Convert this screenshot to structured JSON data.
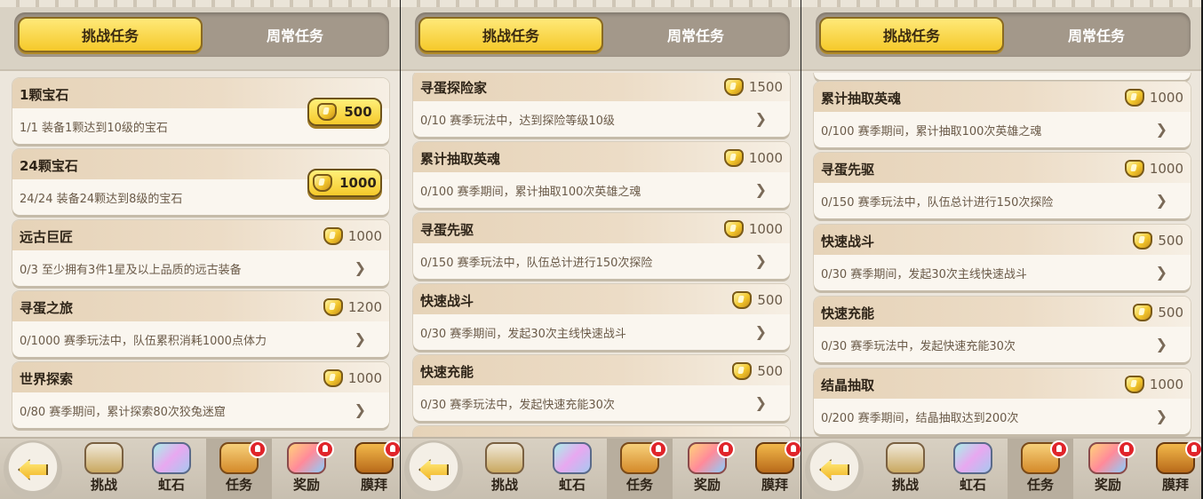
{
  "tabs": {
    "challenge": "挑战任务",
    "weekly": "周常任务"
  },
  "nav": [
    "挑战",
    "虹石",
    "任务",
    "奖励",
    "膜拜"
  ],
  "panels": [
    {
      "cards": [
        {
          "title": "1颗宝石",
          "desc": "1/1 装备1颗达到10级的宝石",
          "reward": "500",
          "claim": true
        },
        {
          "title": "24颗宝石",
          "desc": "24/24 装备24颗达到8级的宝石",
          "reward": "1000",
          "claim": true
        },
        {
          "title": "远古巨匠",
          "desc": "0/3 至少拥有3件1星及以上品质的远古装备",
          "reward": "1000",
          "claim": false
        },
        {
          "title": "寻蛋之旅",
          "desc": "0/1000 赛季玩法中，队伍累积消耗1000点体力",
          "reward": "1200",
          "claim": false
        },
        {
          "title": "世界探索",
          "desc": "0/80 赛季期间，累计探索80次狡兔迷窟",
          "reward": "1000",
          "claim": false
        }
      ]
    },
    {
      "cards": [
        {
          "title": "寻蛋探险家",
          "desc": "0/10 赛季玩法中，达到探险等级10级",
          "reward": "1500",
          "claim": false
        },
        {
          "title": "累计抽取英魂",
          "desc": "0/100 赛季期间，累计抽取100次英雄之魂",
          "reward": "1000",
          "claim": false
        },
        {
          "title": "寻蛋先驱",
          "desc": "0/150 赛季玩法中，队伍总计进行150次探险",
          "reward": "1000",
          "claim": false
        },
        {
          "title": "快速战斗",
          "desc": "0/30 赛季期间，发起30次主线快速战斗",
          "reward": "500",
          "claim": false
        },
        {
          "title": "快速充能",
          "desc": "0/30 赛季玩法中，发起快速充能30次",
          "reward": "500",
          "claim": false
        }
      ]
    },
    {
      "cards": [
        {
          "title": "累计抽取英魂",
          "desc": "0/100 赛季期间，累计抽取100次英雄之魂",
          "reward": "1000",
          "claim": false
        },
        {
          "title": "寻蛋先驱",
          "desc": "0/150 赛季玩法中，队伍总计进行150次探险",
          "reward": "1000",
          "claim": false
        },
        {
          "title": "快速战斗",
          "desc": "0/30 赛季期间，发起30次主线快速战斗",
          "reward": "500",
          "claim": false
        },
        {
          "title": "快速充能",
          "desc": "0/30 赛季玩法中，发起快速充能30次",
          "reward": "500",
          "claim": false
        },
        {
          "title": "结晶抽取",
          "desc": "0/200 赛季期间，结晶抽取达到200次",
          "reward": "1000",
          "claim": false
        }
      ]
    }
  ]
}
